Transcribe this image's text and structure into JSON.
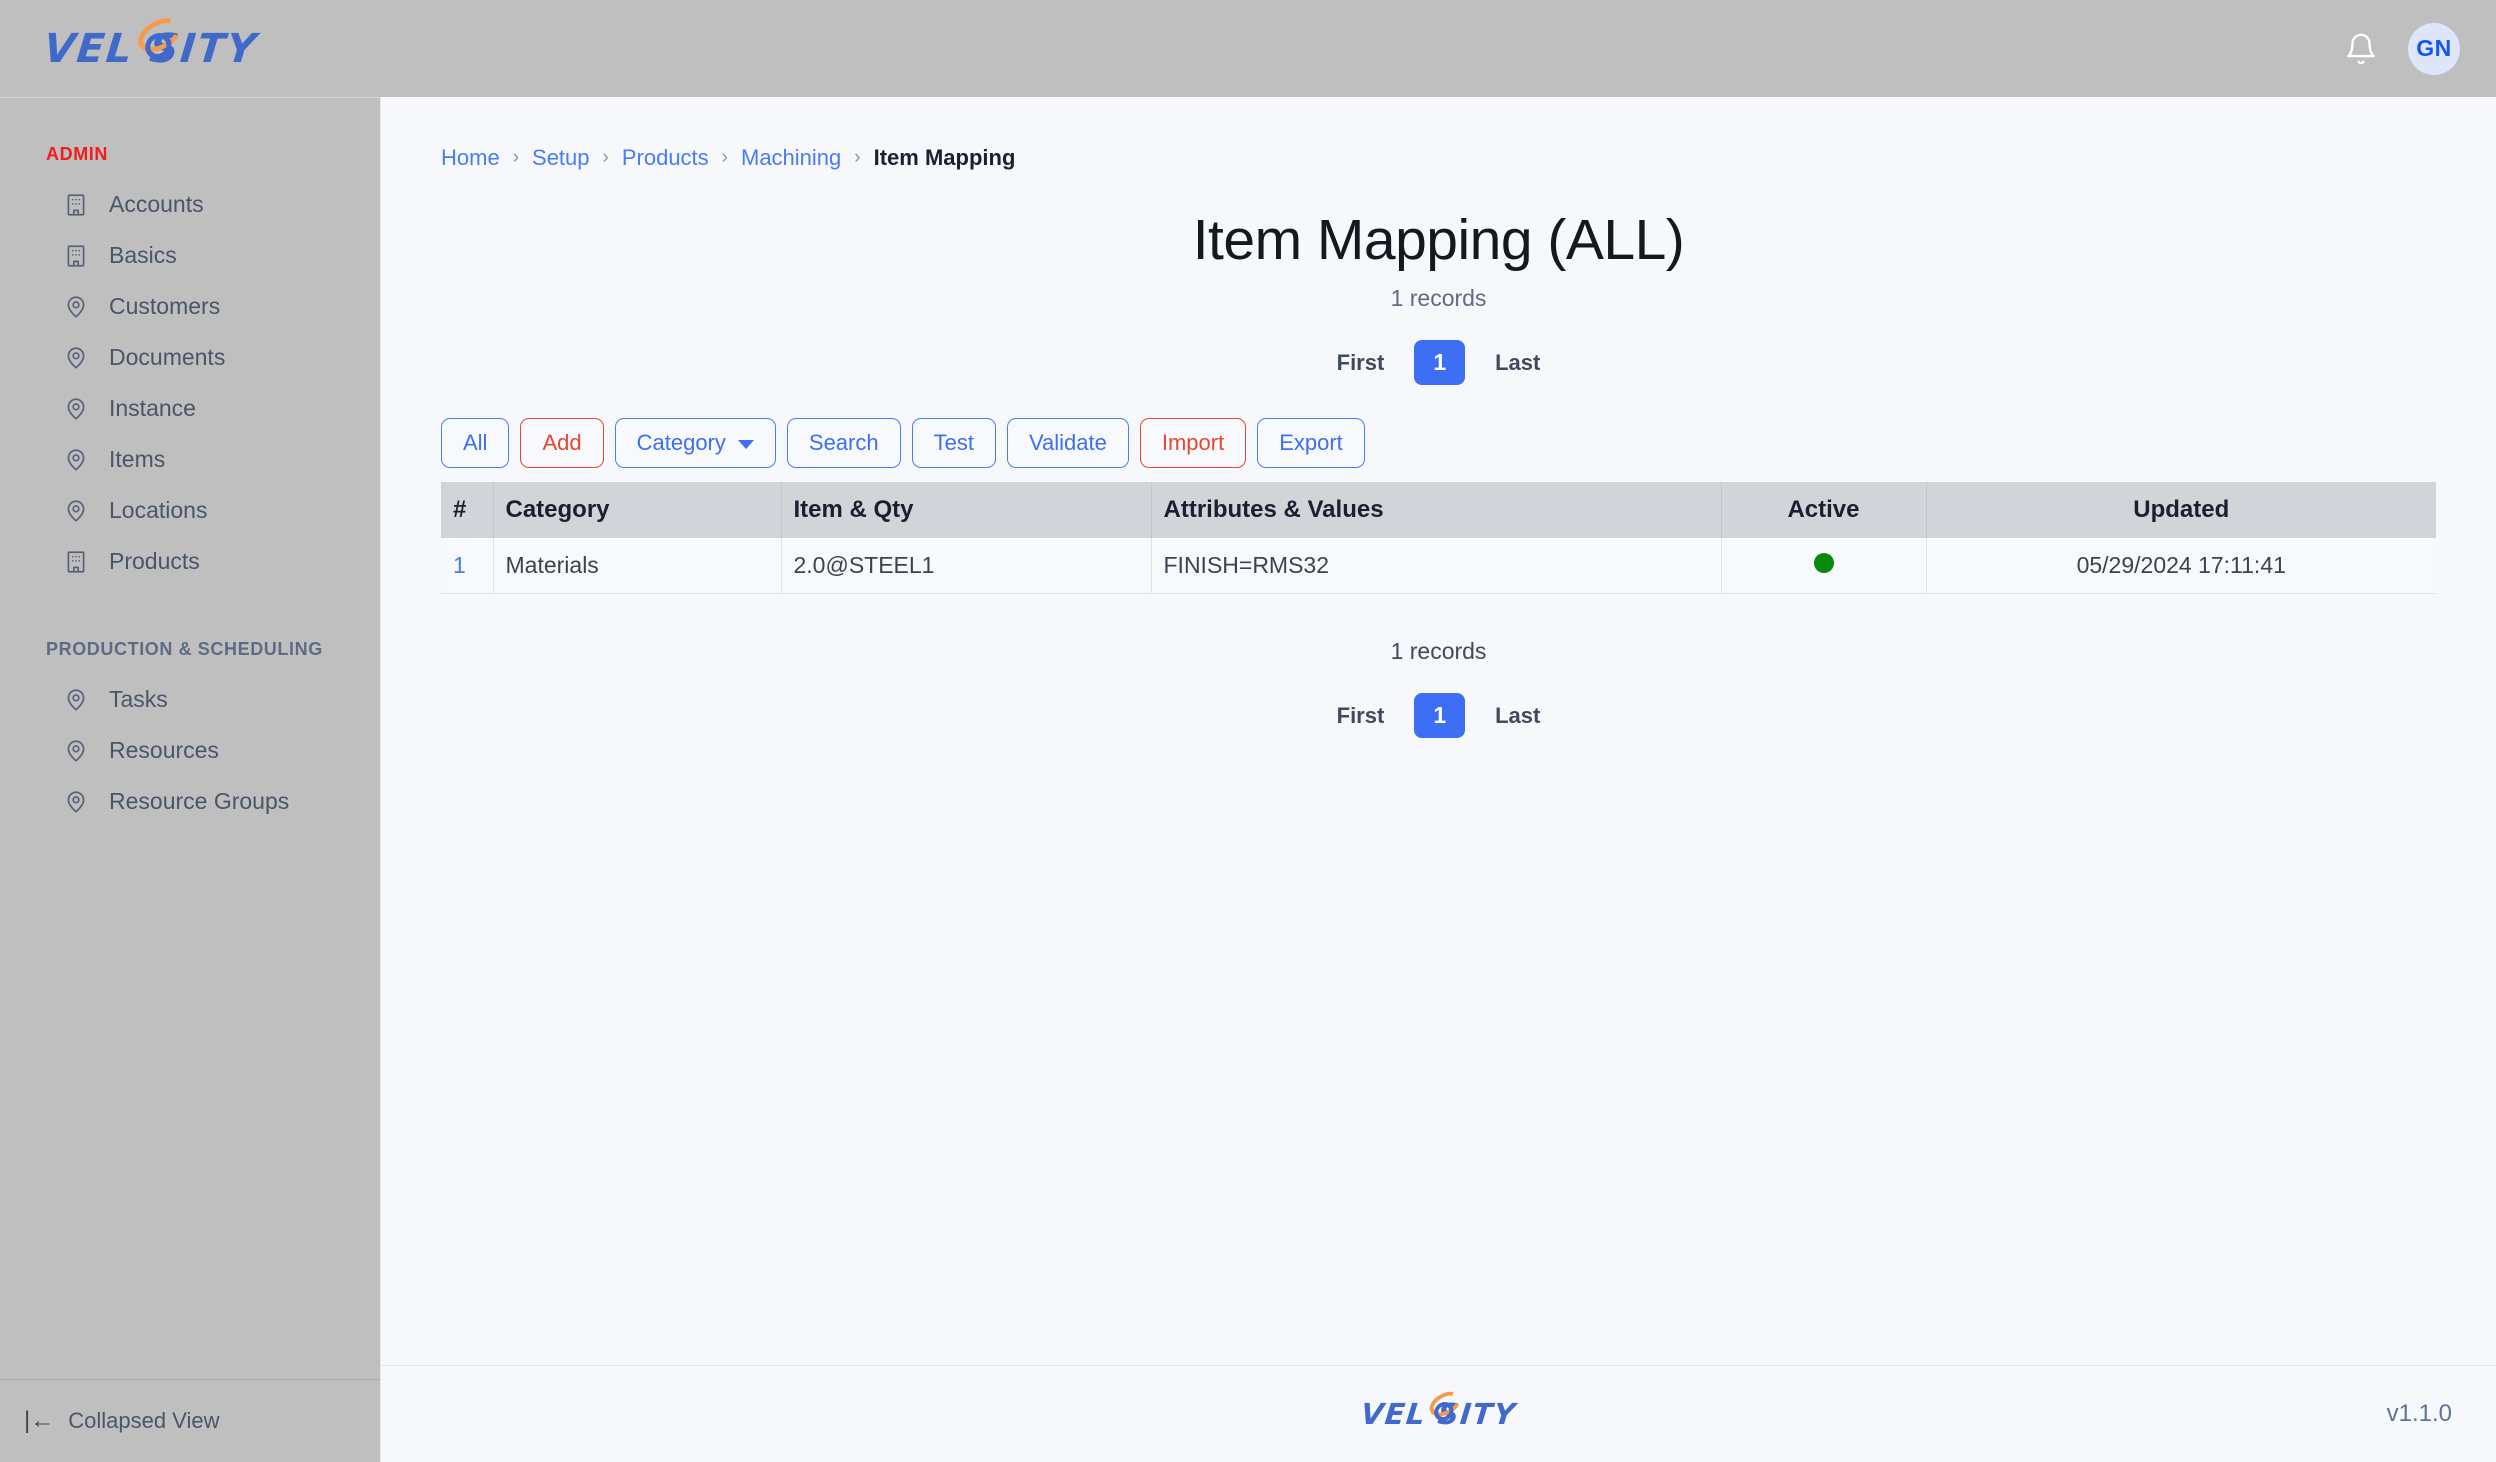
{
  "topbar": {
    "logo_text": "VEL SITY",
    "logo_name": "velosity-logo",
    "bell_icon": "bell-icon",
    "avatar_initials": "GN"
  },
  "sidebar": {
    "groups": [
      {
        "title": "ADMIN",
        "title_color": "#f31c1c",
        "items": [
          {
            "label": "Accounts",
            "icon": "building-icon"
          },
          {
            "label": "Basics",
            "icon": "building-icon"
          },
          {
            "label": "Customers",
            "icon": "map-pin-icon"
          },
          {
            "label": "Documents",
            "icon": "map-pin-icon"
          },
          {
            "label": "Instance",
            "icon": "map-pin-icon"
          },
          {
            "label": "Items",
            "icon": "map-pin-icon"
          },
          {
            "label": "Locations",
            "icon": "map-pin-icon"
          },
          {
            "label": "Products",
            "icon": "building-icon"
          }
        ]
      },
      {
        "title": "PRODUCTION & SCHEDULING",
        "title_color": "#5f6b84",
        "items": [
          {
            "label": "Tasks",
            "icon": "map-pin-icon"
          },
          {
            "label": "Resources",
            "icon": "map-pin-icon"
          },
          {
            "label": "Resource Groups",
            "icon": "map-pin-icon"
          }
        ]
      }
    ],
    "collapse_label": "Collapsed View",
    "collapse_glyph": "|←"
  },
  "breadcrumb": {
    "links": [
      "Home",
      "Setup",
      "Products",
      "Machining"
    ],
    "separator": "›",
    "current": "Item Mapping"
  },
  "page": {
    "title": "Item Mapping (ALL)",
    "records_top": "1 records",
    "records_bottom": "1 records"
  },
  "pager": {
    "first_label": "First",
    "page_number": "1",
    "last_label": "Last",
    "active_color": "#3d6ef3"
  },
  "toolbar": {
    "buttons": [
      {
        "label": "All",
        "style": "primary"
      },
      {
        "label": "Add",
        "style": "danger"
      },
      {
        "label": "Category",
        "style": "primary",
        "dropdown": true
      },
      {
        "label": "Search",
        "style": "primary"
      },
      {
        "label": "Test",
        "style": "primary"
      },
      {
        "label": "Validate",
        "style": "primary"
      },
      {
        "label": "Import",
        "style": "danger"
      },
      {
        "label": "Export",
        "style": "primary"
      }
    ]
  },
  "table": {
    "columns": [
      "#",
      "Category",
      "Item & Qty",
      "Attributes & Values",
      "Active",
      "Updated"
    ],
    "rows": [
      {
        "num": "1",
        "category": "Materials",
        "item_qty": "2.0@STEEL1",
        "attributes": "FINISH=RMS32",
        "active": true,
        "active_color": "#0a8a0a",
        "updated": "05/29/2024 17:11:41"
      }
    ]
  },
  "footer": {
    "logo_text": "VEL SITY",
    "version": "v1.1.0"
  }
}
